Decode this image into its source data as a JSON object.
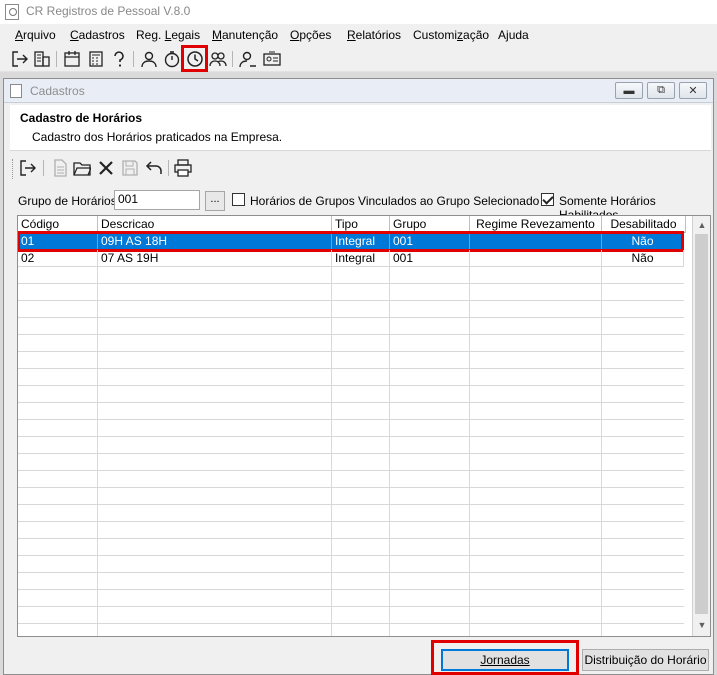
{
  "app": {
    "title": "CR Registros de Pessoal V.8.0"
  },
  "menu": [
    {
      "label": "Arquivo",
      "accel": "A",
      "rest": "rquivo"
    },
    {
      "label": "Cadastros",
      "accel": "C",
      "rest": "adastros"
    },
    {
      "label": "Reg. Legais",
      "pre": "Reg. ",
      "accel": "L",
      "rest": "egais"
    },
    {
      "label": "Manutenção",
      "accel": "M",
      "rest": "anutenção"
    },
    {
      "label": "Opções",
      "accel": "O",
      "rest": "pções"
    },
    {
      "label": "Relatórios",
      "accel": "R",
      "rest": "elatórios"
    },
    {
      "label": "Customização",
      "pre": "Customi",
      "accel": "z",
      "rest": "ação"
    },
    {
      "label": "Ajuda",
      "pre": "A",
      "accel": "j",
      "rest": "uda"
    }
  ],
  "toolbar": {
    "icons": [
      "exit-icon",
      "company-icon",
      "calendar-icon",
      "calculator-icon",
      "help-icon",
      "person-icon",
      "timer-icon",
      "clock-icon",
      "people-icon",
      "user-edit-icon",
      "id-card-icon"
    ],
    "highlighted": "clock-icon"
  },
  "window": {
    "title": "Cadastros"
  },
  "header": {
    "title": "Cadastro de Horários",
    "subtitle": "Cadastro dos Horários praticados na Empresa."
  },
  "filters": {
    "group_label": "Grupo de Horários",
    "group_value": "001",
    "browse_label": "...",
    "linked_groups_label": "Horários de Grupos Vinculados ao Grupo Selecionado",
    "linked_groups_checked": false,
    "enabled_only_label": "Somente Horários Habilitados",
    "enabled_only_checked": true
  },
  "table": {
    "columns": [
      "Código",
      "Descricao",
      "Tipo",
      "Grupo",
      "Regime Revezamento",
      "Desabilitado"
    ],
    "rows": [
      {
        "codigo": "01",
        "descricao": "09H AS 18H",
        "tipo": "Integral",
        "grupo": "001",
        "regime": "",
        "desabilitado": "Não",
        "selected": true
      },
      {
        "codigo": "02",
        "descricao": "07 AS 19H",
        "tipo": "Integral",
        "grupo": "001",
        "regime": "",
        "desabilitado": "Não",
        "selected": false
      }
    ]
  },
  "buttons": {
    "jornadas": "Jornadas",
    "distribuicao": "Distribuição do Horário"
  },
  "colors": {
    "selection": "#0078d7",
    "highlight": "#e00000"
  }
}
